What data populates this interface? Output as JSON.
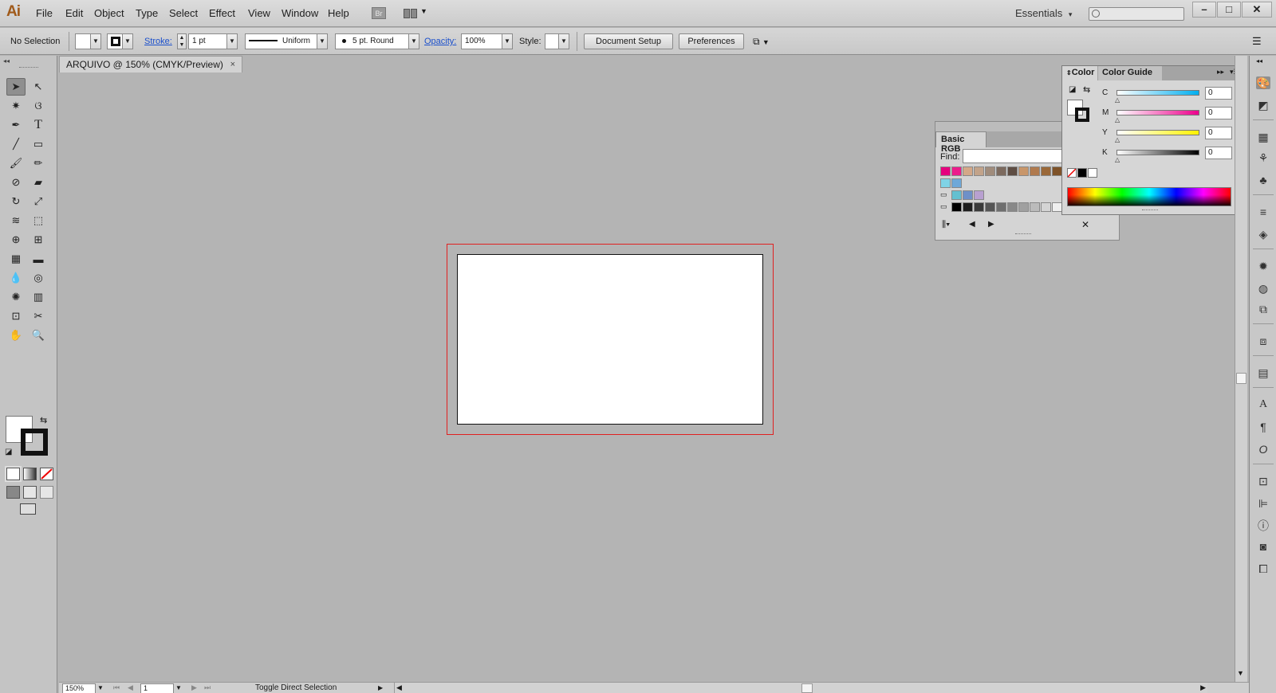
{
  "app": {
    "logo": "Ai"
  },
  "menu": [
    "File",
    "Edit",
    "Object",
    "Type",
    "Select",
    "Effect",
    "View",
    "Window",
    "Help"
  ],
  "bridge_label": "Br",
  "workspace": {
    "label": "Essentials",
    "caret": "▾"
  },
  "window_controls": {
    "minimize": "–",
    "maximize": "□",
    "close": "✕"
  },
  "control": {
    "selection": "No Selection",
    "stroke_label": "Stroke:",
    "stroke_weight": "1 pt",
    "stroke_profile": "Uniform",
    "brush": "5 pt. Round",
    "opacity_label": "Opacity:",
    "opacity_value": "100%",
    "style_label": "Style:",
    "document_setup": "Document Setup",
    "preferences": "Preferences"
  },
  "document_tab": {
    "title": "ARQUIVO @ 150% (CMYK/Preview)",
    "close": "×"
  },
  "swatches": {
    "title": "Basic RGB",
    "find_label": "Find:",
    "find_value": ""
  },
  "color_panel": {
    "tab_color": "Color",
    "tab_guide": "Color Guide",
    "sliders": [
      {
        "label": "C",
        "value": "0",
        "unit": "%",
        "gradient": [
          "#ffffff",
          "#00aeef"
        ]
      },
      {
        "label": "M",
        "value": "0",
        "unit": "%",
        "gradient": [
          "#ffffff",
          "#ec008c"
        ]
      },
      {
        "label": "Y",
        "value": "0",
        "unit": "%",
        "gradient": [
          "#ffffff",
          "#fff200"
        ]
      },
      {
        "label": "K",
        "value": "0",
        "unit": "%",
        "gradient": [
          "#ffffff",
          "#000000"
        ]
      }
    ]
  },
  "status": {
    "zoom": "150%",
    "artboard_number": "1",
    "tool_hint": "Toggle Direct Selection"
  }
}
